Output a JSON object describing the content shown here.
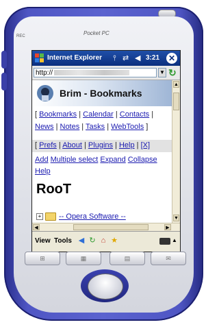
{
  "device": {
    "brand": "Pocket PC",
    "rec_label": "REC"
  },
  "titlebar": {
    "app_title": "Internet Explorer",
    "clock": "3:21",
    "icons": [
      "windows-start-icon",
      "connectivity-icon",
      "network-sync-icon",
      "volume-icon",
      "close-icon"
    ],
    "close_label": "✕"
  },
  "addressbar": {
    "url_prefix": "http://",
    "go_label": "↻"
  },
  "page": {
    "header_title": "Brim - Bookmarks",
    "nav": {
      "bookmarks": "Bookmarks",
      "calendar": "Calendar",
      "contacts": "Contacts",
      "news": "News",
      "notes": "Notes",
      "tasks": "Tasks",
      "webtools": "WebTools"
    },
    "prefs": {
      "prefs": "Prefs",
      "about": "About",
      "plugins": "Plugins",
      "help": "Help",
      "close": "[X]"
    },
    "actions": {
      "add": "Add",
      "multiple_select": "Multiple select",
      "expand": "Expand",
      "collapse": "Collapse",
      "help": "Help"
    },
    "root_title": "RooT",
    "folders": [
      {
        "label": "-- Opera Software --",
        "expander": "+"
      }
    ]
  },
  "menubar": {
    "view": "View",
    "tools": "Tools",
    "icons": [
      "back-icon",
      "refresh-icon",
      "home-icon",
      "favorites-icon",
      "keyboard-icon"
    ]
  },
  "colors": {
    "titlebar": "#0b2f7e",
    "link": "#1a1ab0",
    "device_body": "#4f56c4",
    "scrollbar": "#f1ecd8"
  }
}
